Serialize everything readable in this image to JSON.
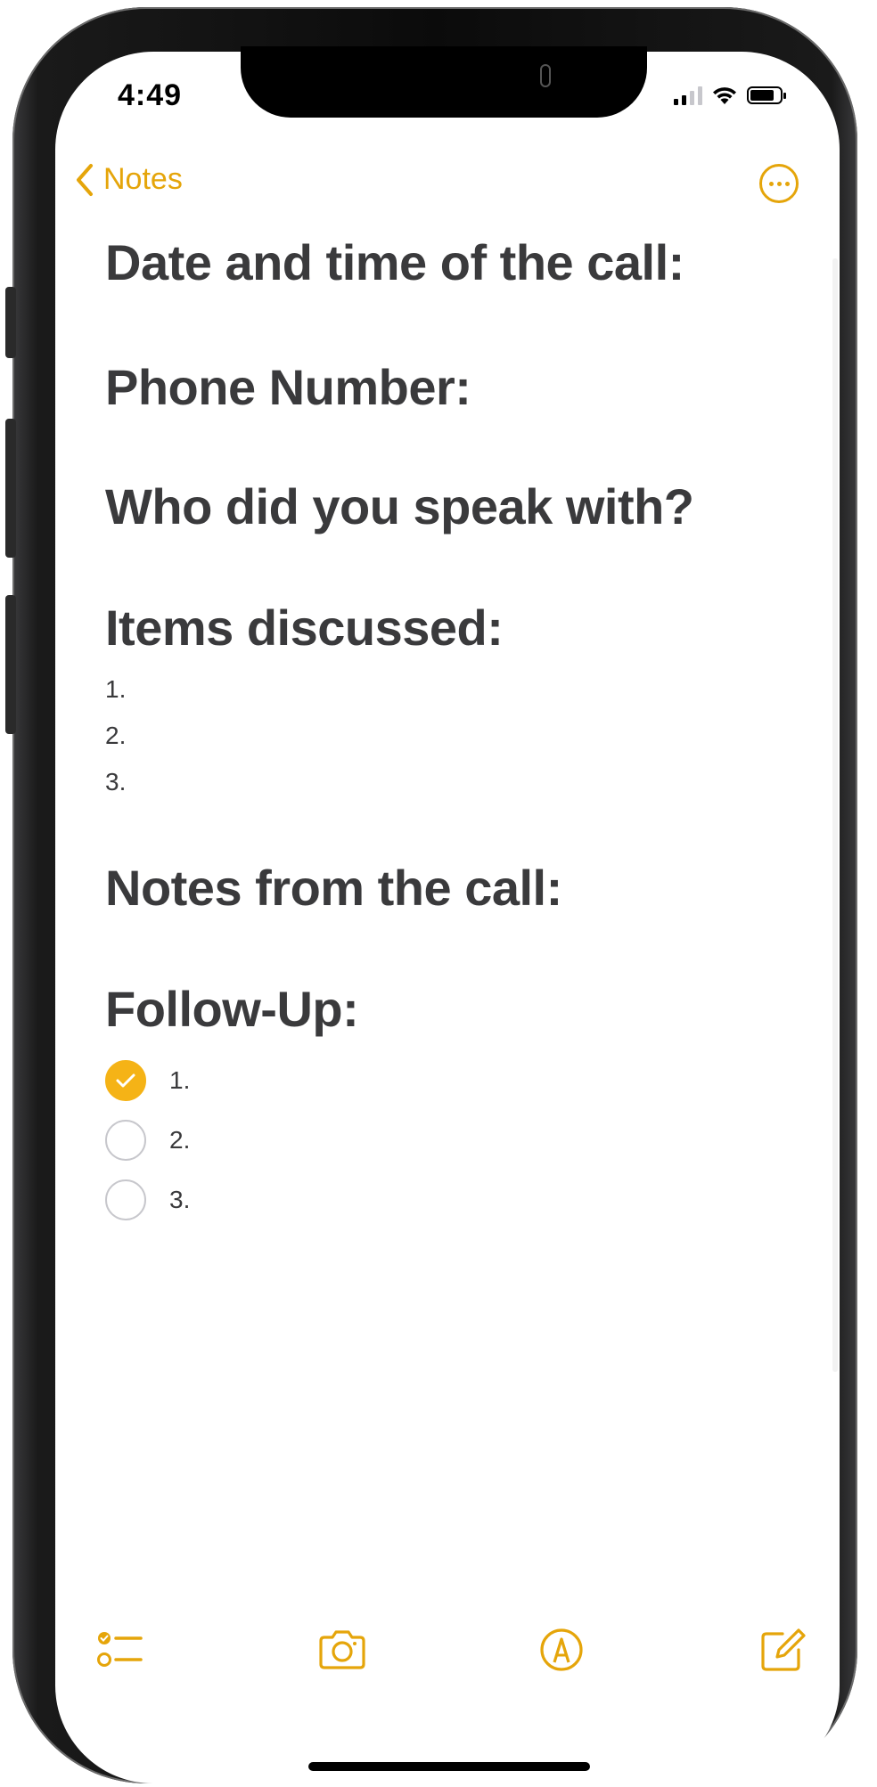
{
  "status": {
    "time": "4:49"
  },
  "nav": {
    "back_label": "Notes"
  },
  "note": {
    "headings": {
      "date_time": "Date and time of the call:",
      "phone": "Phone Number:",
      "who": "Who did you speak with?",
      "items": "Items discussed:",
      "notes": "Notes from the call:",
      "follow_up": "Follow-Up:"
    },
    "items_list": [
      "1.",
      "2.",
      "3."
    ],
    "follow_up_list": [
      {
        "label": "1.",
        "checked": true
      },
      {
        "label": "2.",
        "checked": false
      },
      {
        "label": "3.",
        "checked": false
      }
    ]
  },
  "toolbar": {
    "icons": [
      "checklist-icon",
      "camera-icon",
      "markup-icon",
      "compose-icon"
    ]
  },
  "colors": {
    "accent": "#e5a50a",
    "checked_fill": "#f5b316",
    "heading_text": "#3a3a3c"
  }
}
